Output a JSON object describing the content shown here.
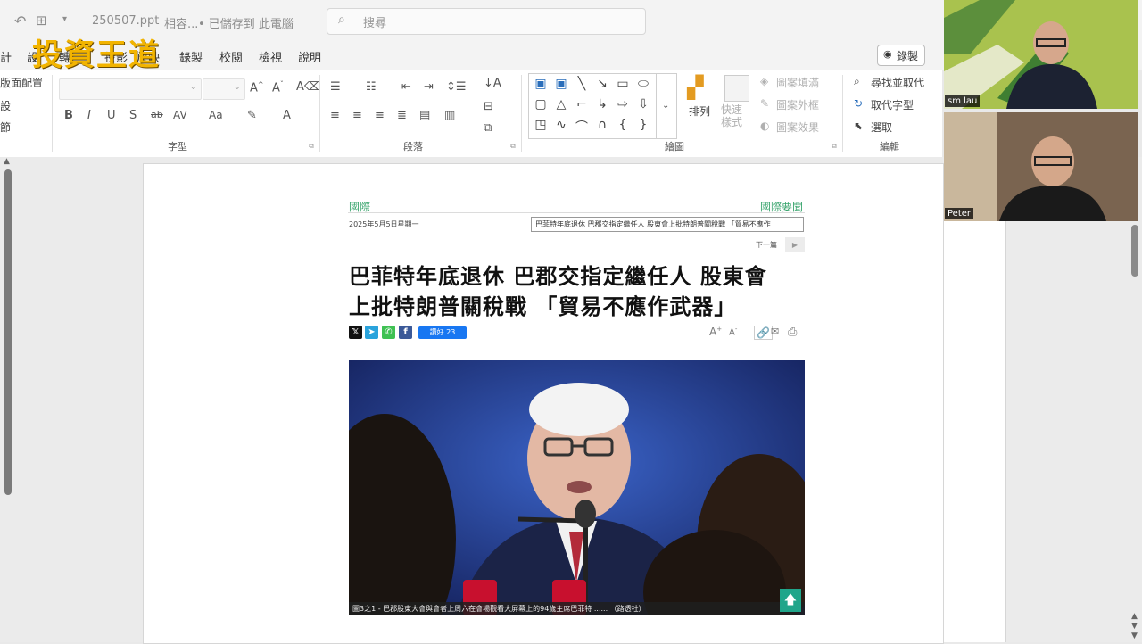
{
  "titlebar": {
    "filename": "250507.ppt",
    "compat": "相容...",
    "saved_status": "• 已儲存到 此電腦",
    "search_placeholder": "搜尋"
  },
  "logo": "投資王道",
  "menu": {
    "items": [
      "計",
      "設",
      "轉",
      "投影",
      "放映",
      "錄製",
      "校閱",
      "檢視",
      "說明"
    ],
    "record_label": "錄製"
  },
  "ribbon": {
    "section_label": "版面配置",
    "groups": {
      "font": "字型",
      "paragraph": "段落",
      "drawing": "繪圖",
      "edit": "編輯"
    },
    "font_buttons": [
      "B",
      "I",
      "U",
      "S",
      "ab",
      "AV",
      "Aa"
    ],
    "arrange_label": "排列",
    "quick_style_label": "快速樣式",
    "shape_fill": "圖案填滿",
    "shape_outline": "圖案外框",
    "shape_effects": "圖案效果",
    "find_replace": "尋找並取代",
    "replace_font": "取代字型",
    "select": "選取"
  },
  "article": {
    "section_left": "國際",
    "section_right": "國際要聞",
    "date": "2025年5月5日星期一",
    "dropdown_value": "巴菲特年底退休 巴郡交指定繼任人 股東會上批特朗普關稅戰 「貿易不應作",
    "next_label": "下一篇",
    "headline_line1": "巴菲特年底退休 巴郡交指定繼任人 股東會",
    "headline_line2": "上批特朗普關稅戰 「貿易不應作武器」",
    "like_label": "讚好 23",
    "caption": "圖3之1 - 巴郡股東大會與會者上周六在會場觀看大屏幕上的94歲主席巴菲特 ...... （路透社）"
  },
  "participants": [
    {
      "name": "sm lau"
    },
    {
      "name": "Peter"
    }
  ],
  "colors": {
    "accent_green": "#3aa56e",
    "logo_gold": "#f2b400"
  }
}
